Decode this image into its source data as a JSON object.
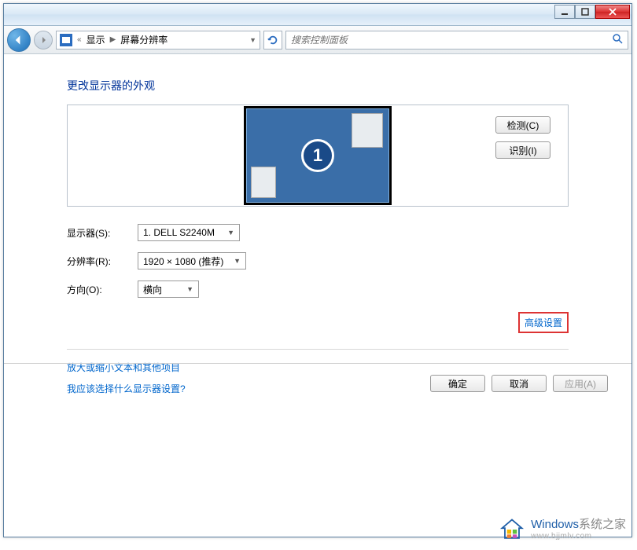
{
  "titlebar": {},
  "navbar": {
    "breadcrumb": {
      "sep_left": "«",
      "item1": "显示",
      "arrow": "▶",
      "item2": "屏幕分辨率"
    },
    "search_placeholder": "搜索控制面板"
  },
  "main": {
    "heading": "更改显示器的外观",
    "monitor_number": "1",
    "detect_btn": "检测(C)",
    "identify_btn": "识别(I)",
    "labels": {
      "display": "显示器(S):",
      "resolution": "分辨率(R):",
      "orientation": "方向(O):"
    },
    "values": {
      "display": "1. DELL S2240M",
      "resolution": "1920 × 1080 (推荐)",
      "orientation": "横向"
    },
    "advanced": "高级设置",
    "help1": "放大或缩小文本和其他项目",
    "help2": "我应该选择什么显示器设置?"
  },
  "actions": {
    "ok": "确定",
    "cancel": "取消",
    "apply": "应用(A)"
  },
  "watermark": {
    "brand_colored": "Windows",
    "brand_rest": "系统之家",
    "url": "www.bjjmlv.com"
  }
}
